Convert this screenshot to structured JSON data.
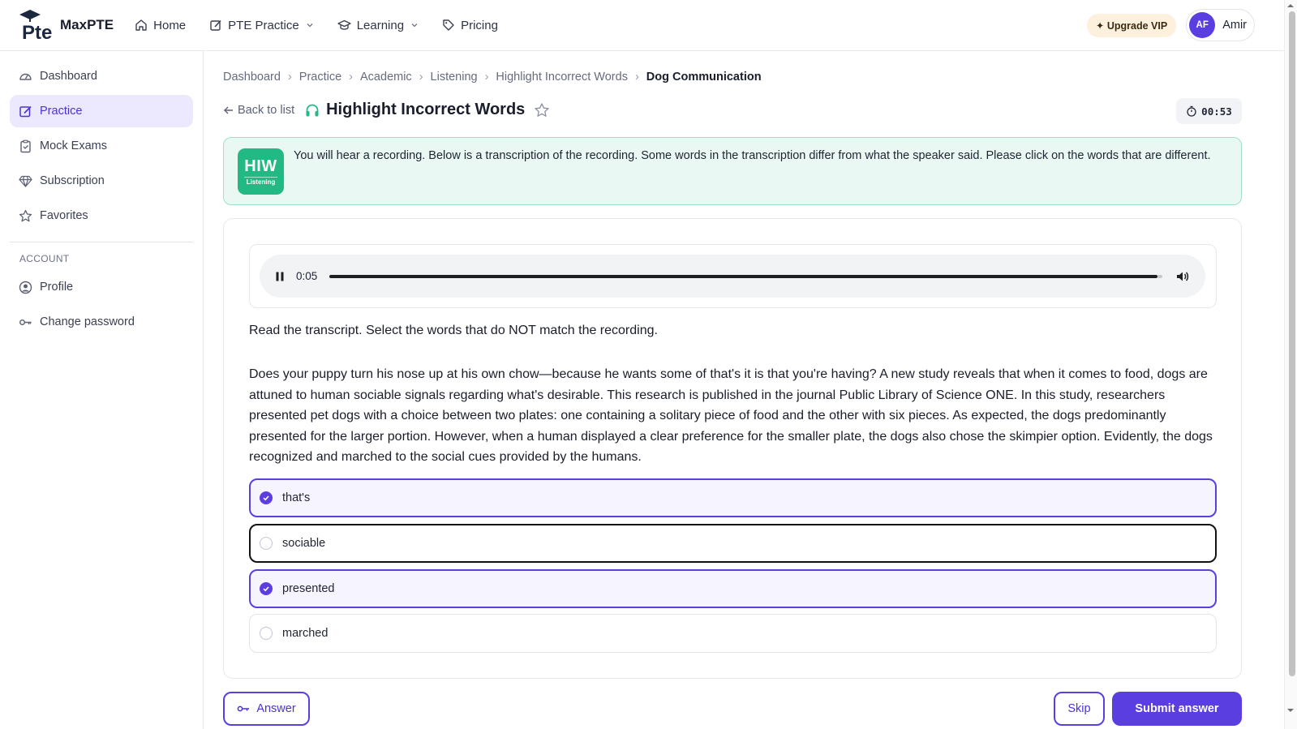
{
  "brand": {
    "name": "MaxPTE",
    "logo_text": "Pte"
  },
  "topnav": {
    "items": [
      {
        "label": "Home",
        "icon": "home-icon"
      },
      {
        "label": "PTE Practice",
        "icon": "edit-icon",
        "has_dropdown": true
      },
      {
        "label": "Learning",
        "icon": "graduation-cap-icon",
        "has_dropdown": true
      },
      {
        "label": "Pricing",
        "icon": "tag-icon"
      }
    ],
    "vip_label": "✦ Upgrade VIP",
    "user": {
      "initials": "AF",
      "name": "Amir"
    }
  },
  "sidebar": {
    "items": [
      {
        "label": "Dashboard",
        "icon": "gauge-icon",
        "active": false
      },
      {
        "label": "Practice",
        "icon": "edit-icon",
        "active": true
      },
      {
        "label": "Mock Exams",
        "icon": "clipboard-icon",
        "active": false
      },
      {
        "label": "Subscription",
        "icon": "diamond-icon",
        "active": false
      },
      {
        "label": "Favorites",
        "icon": "star-icon",
        "active": false
      }
    ],
    "account_heading": "ACCOUNT",
    "account_items": [
      {
        "label": "Profile",
        "icon": "user-circle-icon"
      },
      {
        "label": "Change password",
        "icon": "key-icon"
      }
    ]
  },
  "breadcrumb": [
    "Dashboard",
    "Practice",
    "Academic",
    "Listening",
    "Highlight Incorrect Words",
    "Dog Communication"
  ],
  "header": {
    "back_label": "Back to list",
    "title": "Highlight Incorrect Words",
    "timer": "00:53"
  },
  "instruction": {
    "badge_main": "HIW",
    "badge_sub": "Listening",
    "text": "You will hear a recording. Below is a transcription of the recording. Some words in the transcription differ from what the speaker said. Please click on the words that are different."
  },
  "audio": {
    "current_time": "0:05",
    "progress": 0.994
  },
  "prompt": "Read the transcript. Select the words that do NOT match the recording.",
  "transcript": "Does your puppy turn his nose up at his own chow—because he wants some of that's it is that you're having? A new study reveals that when it comes to food, dogs are attuned to human sociable signals regarding what's desirable. This research is published in the journal Public Library of Science ONE. In this study, researchers presented pet dogs with a choice between two plates: one containing a solitary piece of food and the other with six pieces. As expected, the dogs predominantly presented for the larger portion. However, when a human displayed a clear preference for the smaller plate, the dogs also chose the skimpier option. Evidently, the dogs recognized and marched to the social cues provided by the humans.",
  "options": [
    {
      "label": "that's",
      "selected": true
    },
    {
      "label": "sociable",
      "selected": false
    },
    {
      "label": "presented",
      "selected": true
    },
    {
      "label": "marched",
      "selected": false
    }
  ],
  "actions": {
    "answer": "Answer",
    "skip": "Skip",
    "submit": "Submit answer"
  },
  "colors": {
    "accent": "#5b3ee0",
    "accent_light": "#ece8fd",
    "listening_green": "#23b984",
    "instruction_bg": "#eaf8f3"
  }
}
